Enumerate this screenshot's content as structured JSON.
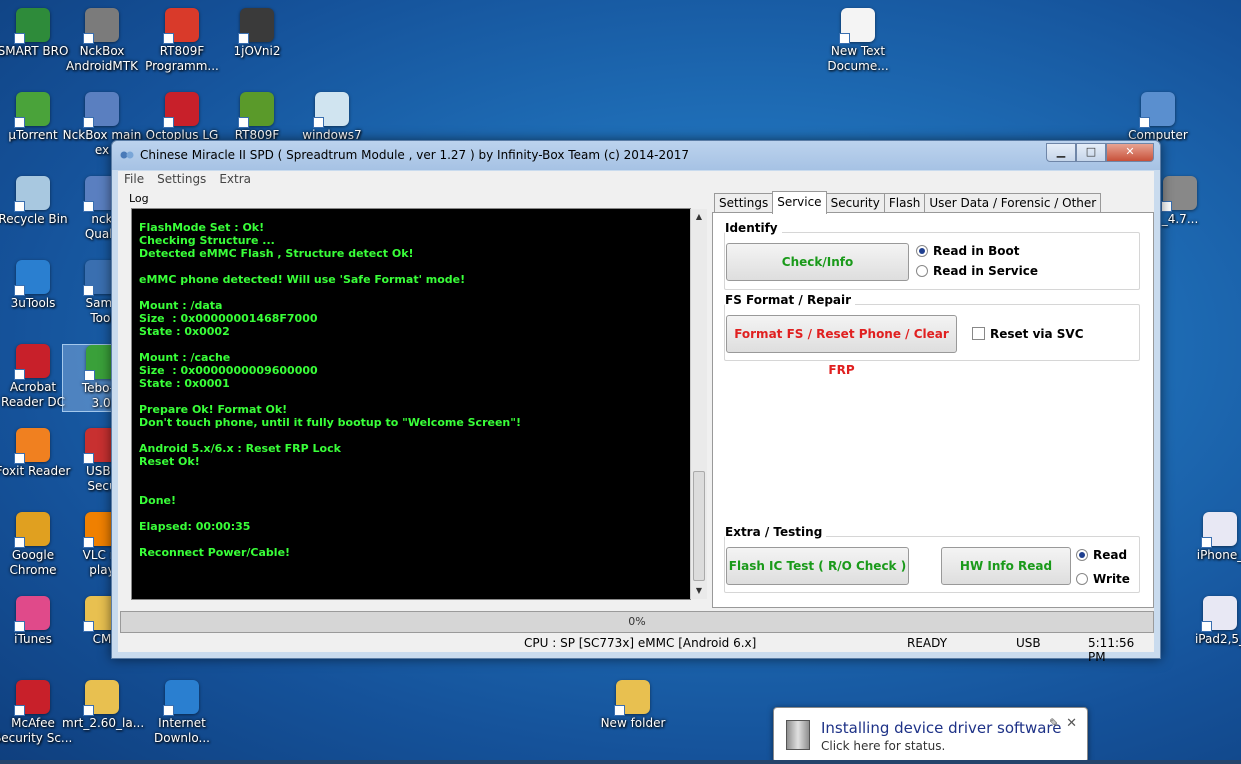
{
  "desktop": {
    "icons": [
      {
        "label": "SMART BRO",
        "color": "#2e8b3a"
      },
      {
        "label": "NckBox\nAndroidMTK",
        "color": "#7b7b7b"
      },
      {
        "label": "RT809F\nProgramm...",
        "color": "#d93a2a"
      },
      {
        "label": "1jOVni2",
        "color": "#3a3a3a"
      },
      {
        "label": "New Text\nDocume...",
        "color": "#f4f4f4"
      },
      {
        "label": "µTorrent",
        "color": "#4aa33a"
      },
      {
        "label": "NckBox main\nex",
        "color": "#5a7fc0"
      },
      {
        "label": "Octoplus LG",
        "color": "#c8202a"
      },
      {
        "label": "RT809F",
        "color": "#5a9a2a"
      },
      {
        "label": "windows7",
        "color": "#d0e4f0"
      },
      {
        "label": "Computer",
        "color": "#5a8fcf"
      },
      {
        "label": "Recycle Bin",
        "color": "#a8c8e0"
      },
      {
        "label": "nck\nQualc",
        "color": "#5a7fc0"
      },
      {
        "label": "_4.7...",
        "color": "#888888"
      },
      {
        "label": "3uTools",
        "color": "#2a7fd0"
      },
      {
        "label": "Sams\nTool",
        "color": "#3a6fb0"
      },
      {
        "label": "Acrobat\nReader DC",
        "color": "#c8202a"
      },
      {
        "label": "Tebo-Ic\n3.0.",
        "color": "#3aa03a"
      },
      {
        "label": "Foxit Reader",
        "color": "#f08020"
      },
      {
        "label": "USB I\nSecu",
        "color": "#c83030"
      },
      {
        "label": "Google\nChrome",
        "color": "#e0a020"
      },
      {
        "label": "VLC m\nplay",
        "color": "#f08000"
      },
      {
        "label": "iPhone_",
        "color": "#e8e8f4"
      },
      {
        "label": "iTunes",
        "color": "#e04a8a"
      },
      {
        "label": "CM",
        "color": "#e8c050"
      },
      {
        "label": "iPad2,5_",
        "color": "#e8e8f4"
      },
      {
        "label": "McAfee\nSecurity Sc...",
        "color": "#c8202a"
      },
      {
        "label": "mrt_2.60_la...",
        "color": "#e8c050"
      },
      {
        "label": "Internet\nDownlo...",
        "color": "#2a7fd0"
      },
      {
        "label": "New folder",
        "color": "#e8c050"
      }
    ]
  },
  "window": {
    "title": "Chinese Miracle II SPD ( Spreadtrum Module , ver 1.27 ) by Infinity-Box Team (c) 2014-2017",
    "buttons": {
      "minimize": "▁",
      "maximize": "□",
      "close": "✕"
    },
    "menu": [
      "File",
      "Settings",
      "Extra"
    ],
    "log_label": "Log",
    "log_text": "FlashMode Set : Ok!\nChecking Structure ...\nDetected eMMC Flash , Structure detect Ok!\n\neMMC phone detected! Will use 'Safe Format' mode!\n\nMount : /data\nSize  : 0x00000001468F7000\nState : 0x0002\n\nMount : /cache\nSize  : 0x0000000009600000\nState : 0x0001\n\nPrepare Ok! Format Ok!\nDon't touch phone, until it fully bootup to \"Welcome Screen\"!\n\nAndroid 5.x/6.x : Reset FRP Lock\nReset Ok!\n\n\nDone!\n\nElapsed: 00:00:35\n\nReconnect Power/Cable!",
    "tabs": [
      "Settings",
      "Service",
      "Security",
      "Flash",
      "User Data / Forensic / Other"
    ],
    "active_tab": "Service",
    "identify": {
      "title": "Identify",
      "button": "Check/Info",
      "radio_boot": "Read in Boot",
      "radio_service": "Read in Service"
    },
    "fs_format": {
      "title": "FS Format / Repair",
      "button": "Format FS / Reset Phone / Clear FRP",
      "checkbox": "Reset via SVC"
    },
    "extra": {
      "title": "Extra / Testing",
      "flash_ic_button": "Flash IC Test ( R/O Check )",
      "hw_info_button": "HW Info Read",
      "radio_read": "Read",
      "radio_write": "Write"
    },
    "progress_text": "0%",
    "progress_value": 0,
    "status": {
      "cpu": "CPU : SP [SC773x] eMMC [Android 6.x]",
      "state": "READY",
      "port": "USB",
      "time": "5:11:56 PM"
    }
  },
  "balloon": {
    "title": "Installing device driver software",
    "subtitle": "Click here for status.",
    "close": "✕",
    "pin": "✎"
  },
  "colors": {
    "green_text": "#1a9a1a",
    "red_text": "#e02020",
    "log_green": "#39ff39"
  }
}
